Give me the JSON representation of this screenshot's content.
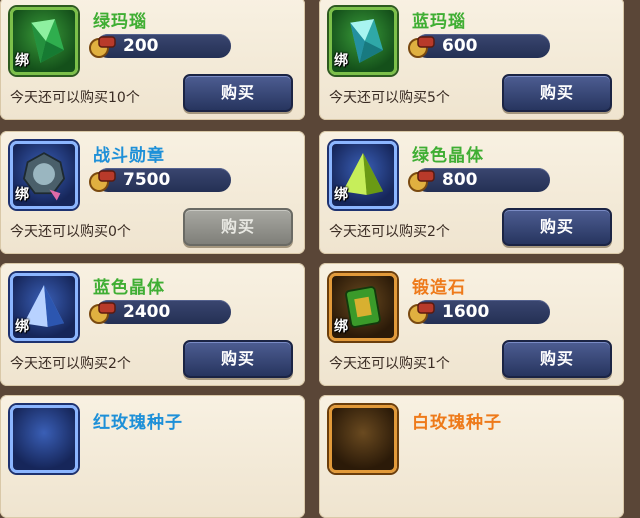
{
  "bind_label": "绑",
  "items": [
    {
      "name": "绿玛瑙",
      "price": "200",
      "limit": "今天还可以购买10个",
      "buy": "购买",
      "name_color": "green",
      "frame": "green",
      "icon": "green-agate-icon",
      "enabled": true
    },
    {
      "name": "蓝玛瑙",
      "price": "600",
      "limit": "今天还可以购买5个",
      "buy": "购买",
      "name_color": "green",
      "frame": "green",
      "icon": "blue-agate-icon",
      "enabled": true
    },
    {
      "name": "战斗勋章",
      "price": "7500",
      "limit": "今天还可以购买0个",
      "buy": "购买",
      "name_color": "blue",
      "frame": "blue",
      "icon": "battle-medal-icon",
      "enabled": false
    },
    {
      "name": "绿色晶体",
      "price": "800",
      "limit": "今天还可以购买2个",
      "buy": "购买",
      "name_color": "green",
      "frame": "blue",
      "icon": "green-crystal-icon",
      "enabled": true
    },
    {
      "name": "蓝色晶体",
      "price": "2400",
      "limit": "今天还可以购买2个",
      "buy": "购买",
      "name_color": "green",
      "frame": "blue",
      "icon": "blue-crystal-icon",
      "enabled": true
    },
    {
      "name": "锻造石",
      "price": "1600",
      "limit": "今天还可以购买1个",
      "buy": "购买",
      "name_color": "orange",
      "frame": "orange",
      "icon": "forging-stone-icon",
      "enabled": true
    },
    {
      "name": "红玫瑰种子",
      "name_color": "blue",
      "frame": "blue"
    },
    {
      "name": "白玫瑰种子",
      "name_color": "orange",
      "frame": "orange"
    }
  ],
  "colors": {
    "green_name": "#3fae33",
    "blue_name": "#1e90d8",
    "orange_name": "#ee7a1a",
    "button": "#34427a"
  }
}
